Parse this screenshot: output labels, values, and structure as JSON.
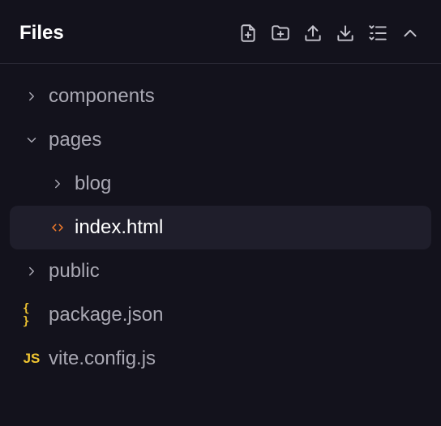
{
  "header": {
    "title": "Files",
    "actions": [
      {
        "name": "new-file-icon"
      },
      {
        "name": "new-folder-icon"
      },
      {
        "name": "upload-icon"
      },
      {
        "name": "download-icon"
      },
      {
        "name": "collapse-all-icon"
      },
      {
        "name": "chevron-up-icon"
      }
    ]
  },
  "tree": {
    "items": [
      {
        "label": "components",
        "type": "folder",
        "state": "collapsed",
        "depth": 0
      },
      {
        "label": "pages",
        "type": "folder",
        "state": "expanded",
        "depth": 0
      },
      {
        "label": "blog",
        "type": "folder",
        "state": "collapsed",
        "depth": 1
      },
      {
        "label": "index.html",
        "type": "html-file",
        "selected": true,
        "depth": 1
      },
      {
        "label": "public",
        "type": "folder",
        "state": "collapsed",
        "depth": 0
      },
      {
        "label": "package.json",
        "type": "json-file",
        "icon_text": "{ }",
        "depth": 0
      },
      {
        "label": "vite.config.js",
        "type": "js-file",
        "icon_text": "JS",
        "depth": 0
      }
    ]
  },
  "colors": {
    "background": "#13121c",
    "selected_row": "#1f1e2b",
    "text": "#a9a8b3",
    "text_selected": "#ffffff",
    "html_icon": "#f07a2b",
    "json_js_icon": "#f0c531"
  }
}
